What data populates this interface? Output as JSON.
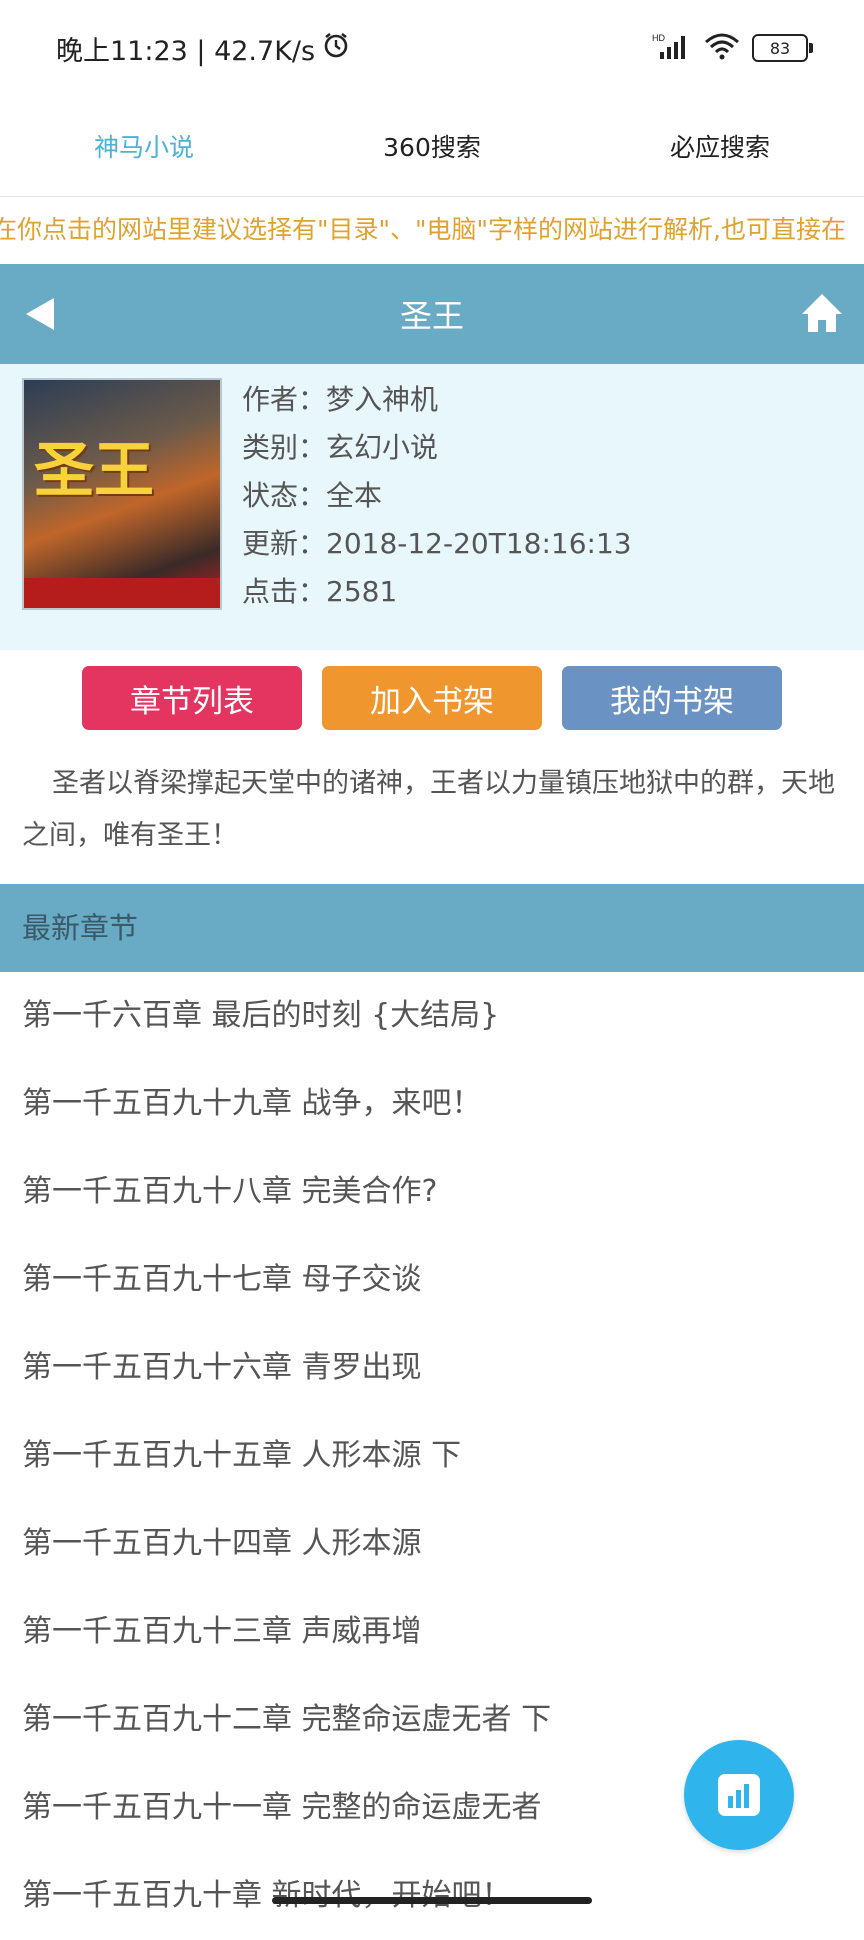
{
  "status_bar": {
    "time_speed": "晚上11:23 | 42.7K/s",
    "battery": "83"
  },
  "tabs": [
    {
      "label": "神马小说",
      "active": true
    },
    {
      "label": "360搜索",
      "active": false
    },
    {
      "label": "必应搜索",
      "active": false
    }
  ],
  "notice": "在你点击的网站里建议选择有\"目录\"、\"电脑\"字样的网站进行解析,也可直接在",
  "header": {
    "title": "圣王"
  },
  "book": {
    "cover_title": "圣王",
    "author": "作者：梦入神机",
    "category": "类别：玄幻小说",
    "status": "状态：全本",
    "updated": "更新：2018-12-20T18:16:13",
    "clicks": "点击：2581"
  },
  "actions": {
    "chapter_list": "章节列表",
    "add_shelf": "加入书架",
    "my_shelf": "我的书架"
  },
  "description": "圣者以脊梁撑起天堂中的诸神，王者以力量镇压地狱中的群，天地之间，唯有圣王！",
  "latest_section": "最新章节",
  "chapters": [
    "第一千六百章 最后的时刻 {大结局}",
    "第一千五百九十九章 战争，来吧！",
    "第一千五百九十八章 完美合作?",
    "第一千五百九十七章 母子交谈",
    "第一千五百九十六章 青罗出现",
    "第一千五百九十五章 人形本源 下",
    "第一千五百九十四章 人形本源",
    "第一千五百九十三章 声威再增",
    "第一千五百九十二章 完整命运虚无者 下",
    "第一千五百九十一章 完整的命运虚无者",
    "第一千五百九十章 新时代，开始吧！"
  ],
  "colors": {
    "header": "#69aac4",
    "info_bg": "#e8f7fc",
    "accent_tab": "#4ab3d6",
    "notice": "#e0a22e",
    "btn_red": "#e33560",
    "btn_orange": "#f0962f",
    "btn_blue": "#6a92c2",
    "fab": "#2fb5ec"
  }
}
